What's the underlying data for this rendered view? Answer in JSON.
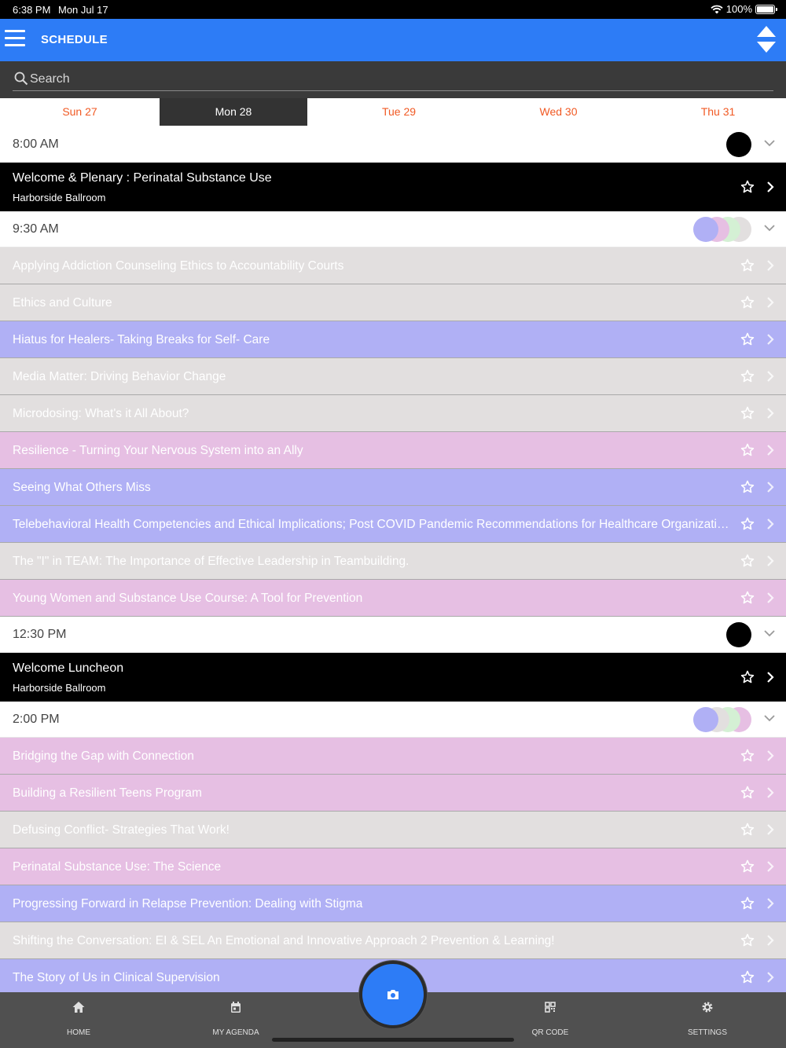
{
  "status_bar": {
    "time": "6:38 PM",
    "date": "Mon Jul 17",
    "battery": "100%"
  },
  "header": {
    "title": "SCHEDULE"
  },
  "search": {
    "placeholder": "Search"
  },
  "days": [
    {
      "label": "Sun 27",
      "active": false
    },
    {
      "label": "Mon 28",
      "active": true
    },
    {
      "label": "Tue 29",
      "active": false
    },
    {
      "label": "Wed 30",
      "active": false
    },
    {
      "label": "Thu 31",
      "active": false
    }
  ],
  "colors": {
    "accent": "#2d7cf6",
    "tab_text": "#f15a24",
    "purple": "#b0b0f5",
    "gray": "#e2dfdf",
    "pink": "#e6bfe3",
    "green": "#d4f0d4",
    "black": "#000000"
  },
  "schedule": [
    {
      "time": "8:00 AM",
      "dot_colors": [
        "#000000"
      ],
      "featured": {
        "title": "Welcome & Plenary : Perinatal Substance Use",
        "location": "Harborside Ballroom"
      },
      "sessions": []
    },
    {
      "time": "9:30 AM",
      "dot_colors": [
        "#b0b0f5",
        "#e6bfe3",
        "#d4f0d4",
        "#e2dfdf"
      ],
      "featured": null,
      "sessions": [
        {
          "title": "Applying Addiction Counseling Ethics to Accountability Courts",
          "color": "gray"
        },
        {
          "title": "Ethics and Culture",
          "color": "gray"
        },
        {
          "title": "Hiatus for Healers- Taking Breaks for Self- Care",
          "color": "purple"
        },
        {
          "title": "Media Matter: Driving Behavior Change",
          "color": "gray"
        },
        {
          "title": "Microdosing: What's it All About?",
          "color": "gray"
        },
        {
          "title": "Resilience - Turning Your Nervous System into an Ally",
          "color": "pink"
        },
        {
          "title": "Seeing What Others Miss",
          "color": "purple"
        },
        {
          "title": "Telebehavioral Health Competencies and Ethical Implications; Post COVID Pandemic Recommendations for Healthcare Organizations",
          "color": "purple"
        },
        {
          "title": "The \"I\" in TEAM: The Importance of Effective Leadership in Teambuilding.",
          "color": "gray"
        },
        {
          "title": "Young Women and Substance Use Course: A Tool for Prevention",
          "color": "pink"
        }
      ]
    },
    {
      "time": "12:30 PM",
      "dot_colors": [
        "#000000"
      ],
      "featured": {
        "title": "Welcome Luncheon",
        "location": "Harborside Ballroom"
      },
      "sessions": []
    },
    {
      "time": "2:00 PM",
      "dot_colors": [
        "#b0b0f5",
        "#e2dfdf",
        "#d4f0d4",
        "#e6bfe3"
      ],
      "featured": null,
      "sessions": [
        {
          "title": "Bridging the Gap with Connection",
          "color": "pink"
        },
        {
          "title": "Building a Resilient Teens Program",
          "color": "pink"
        },
        {
          "title": "Defusing Conflict- Strategies That Work!",
          "color": "gray"
        },
        {
          "title": "Perinatal Substance Use: The Science",
          "color": "pink"
        },
        {
          "title": "Progressing Forward in Relapse Prevention: Dealing with Stigma",
          "color": "purple"
        },
        {
          "title": "Shifting the Conversation: EI & SEL An Emotional and Innovative Approach 2 Prevention & Learning!",
          "color": "gray"
        },
        {
          "title": "The Story of Us in Clinical Supervision",
          "color": "purple"
        }
      ]
    }
  ],
  "bottom_nav": [
    {
      "label": "HOME",
      "icon": "home-icon"
    },
    {
      "label": "MY AGENDA",
      "icon": "calendar-icon"
    },
    {
      "label": "QR CODE",
      "icon": "qr-code-icon"
    },
    {
      "label": "SETTINGS",
      "icon": "gear-icon"
    }
  ],
  "fab": {
    "icon": "camera-icon"
  }
}
